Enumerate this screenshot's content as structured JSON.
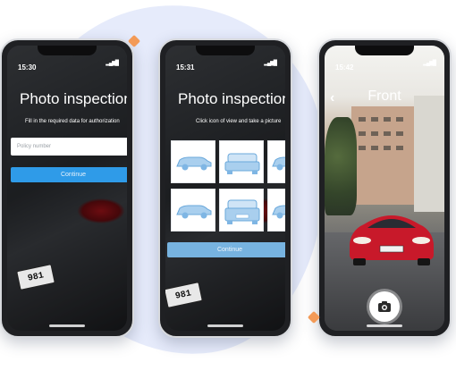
{
  "phones": [
    {
      "time": "15:30",
      "title": "Photo inspection",
      "subtitle": "Fill in the required data for authorization",
      "input_placeholder": "Policy number",
      "button": "Continue",
      "plate": "981"
    },
    {
      "time": "15:31",
      "title": "Photo inspection",
      "subtitle": "Click icon of view and take a picture",
      "button": "Continue",
      "plate": "981"
    },
    {
      "time": "15:42",
      "title": "Front"
    }
  ],
  "colors": {
    "accent_blue": "#2f9be8",
    "muted_blue": "#77b3e0",
    "background_blob": "#e6ebfb",
    "marker_orange": "#f39a57"
  },
  "icons": [
    "back-chevron-icon",
    "camera-icon",
    "signal-icon",
    "car-view-icon"
  ]
}
